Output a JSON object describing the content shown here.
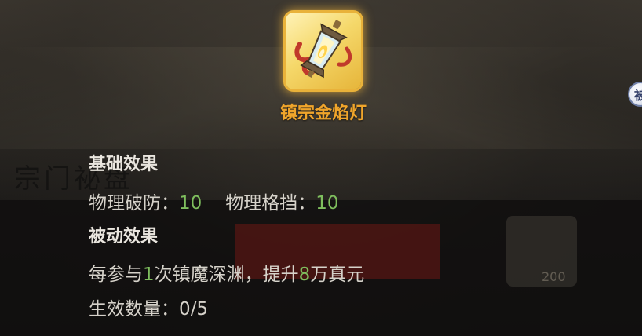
{
  "background": {
    "faded_text": "宗门祕盘",
    "flame_badge_number": "200"
  },
  "item": {
    "name": "镇宗金焰灯",
    "badge_label": "被",
    "icon": "lantern-icon"
  },
  "basic_effect": {
    "title": "基础效果",
    "stats": [
      {
        "label": "物理破防：",
        "value": "10"
      },
      {
        "label": "物理格挡：",
        "value": "10"
      }
    ]
  },
  "passive_effect": {
    "title": "被动效果",
    "desc_part1": "每参与",
    "desc_num1": "1",
    "desc_part2": "次镇魔深渊，提升",
    "desc_num2": "8",
    "desc_part3": "万真元",
    "count_label": "生效数量：",
    "count_value": "0/5"
  },
  "colors": {
    "item_name": "#f0a52b",
    "value_green": "#7fbf5e",
    "text": "#d6d2ca"
  }
}
